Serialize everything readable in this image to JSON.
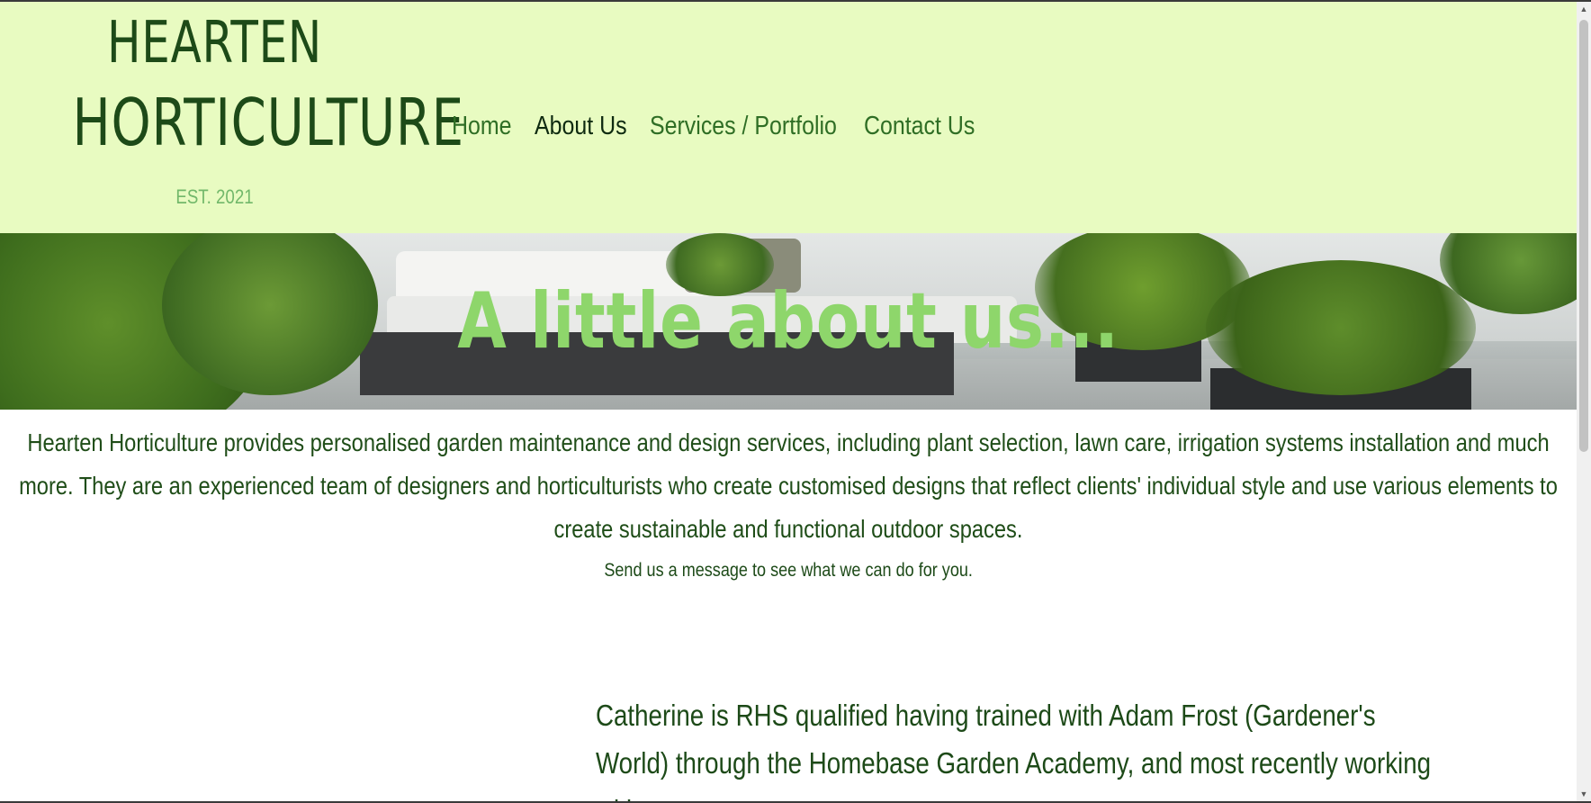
{
  "header": {
    "logo_line1": "HEARTEN",
    "logo_line2": "HORTICULTURE",
    "est": "EST. 2021",
    "nav": [
      {
        "label": "Home",
        "active": false
      },
      {
        "label": "About Us",
        "active": true
      },
      {
        "label": "Services / Portfolio",
        "active": false
      },
      {
        "label": "Contact Us",
        "active": false
      }
    ]
  },
  "hero": {
    "title": "A little about us..."
  },
  "intro": {
    "text": "Hearten Horticulture provides personalised garden maintenance and design services, including plant selection, lawn care, irrigation systems installation and much more. They are an experienced team of designers and horticulturists who create customised designs that reflect clients' individual style and use various elements to create sustainable and functional outdoor spaces.",
    "message": "Send us a message to see what we can do for you."
  },
  "bio": {
    "text": "Catherine is RHS qualified having trained with Adam Frost (Gardener's World) through the Homebase Garden Academy, and most recently working with an"
  },
  "colors": {
    "header_bg": "#e8fbc1",
    "brand_dark_green": "#1d4a18",
    "nav_green": "#2f6e25",
    "hero_title": "#8ed66b"
  }
}
